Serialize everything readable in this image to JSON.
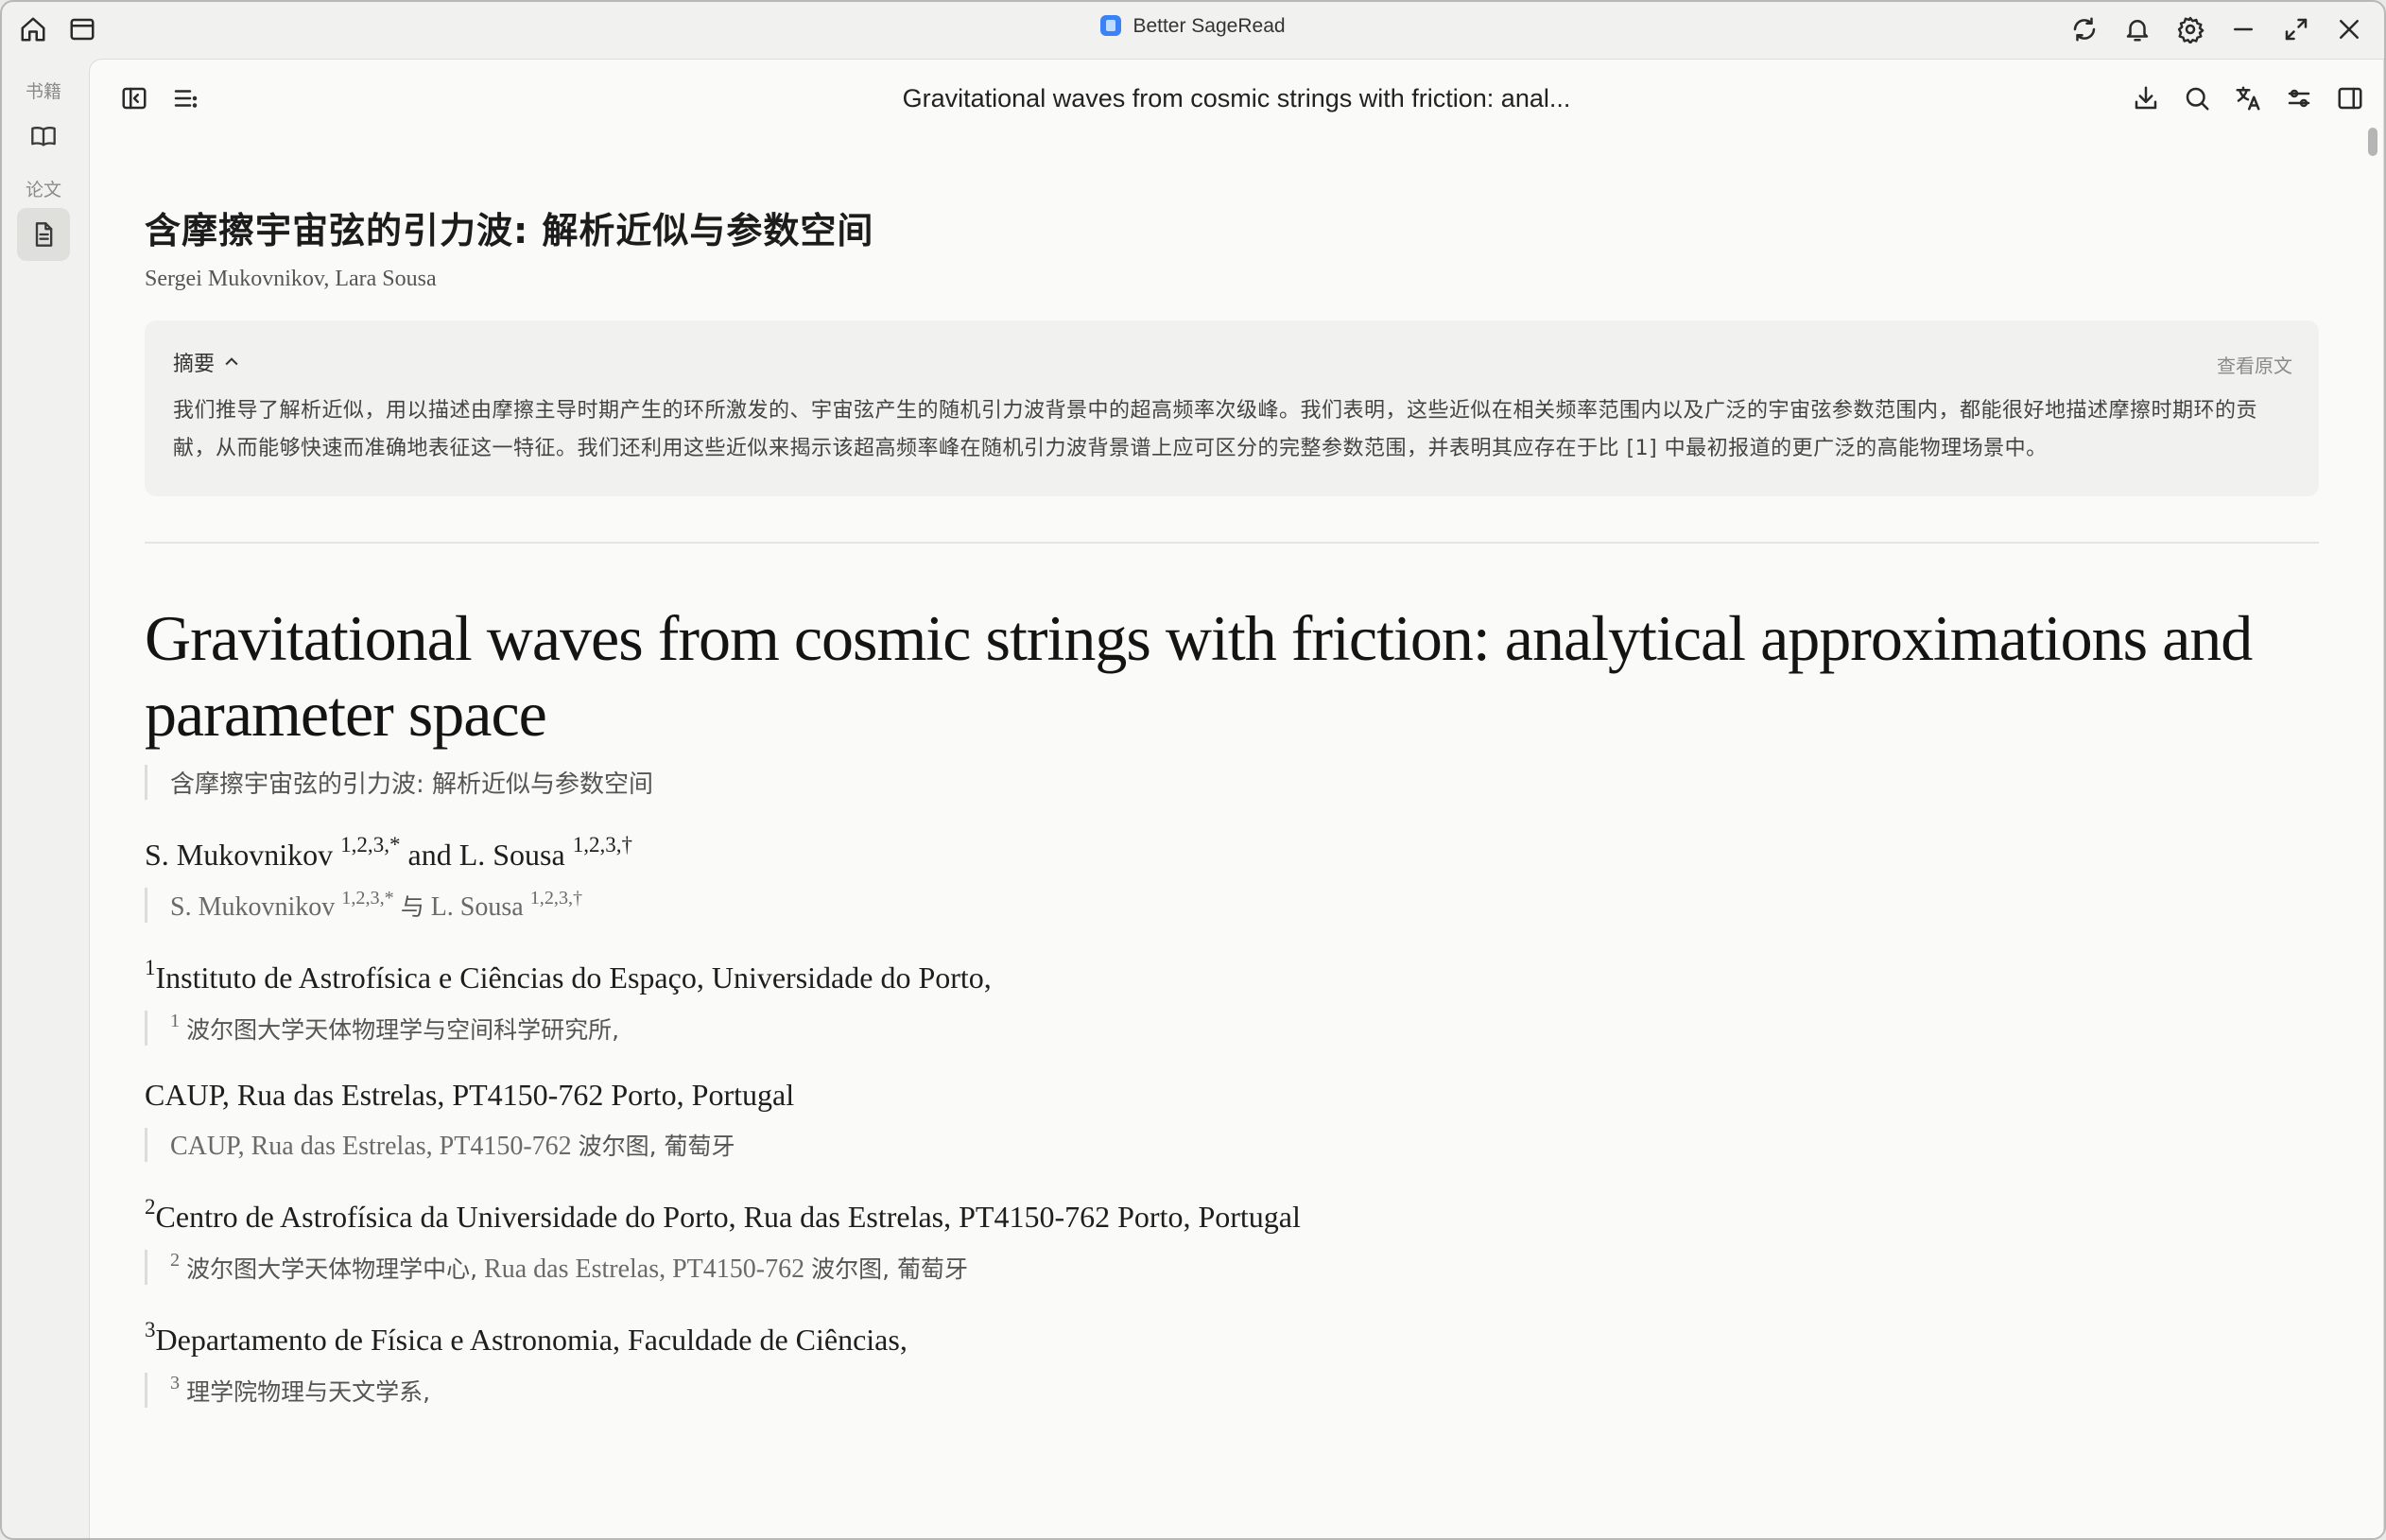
{
  "window": {
    "app_title": "Better SageRead"
  },
  "rail": {
    "label_books": "书籍",
    "label_papers": "论文"
  },
  "toolbar": {
    "doc_title": "Gravitational waves from cosmic strings with friction: anal..."
  },
  "paper": {
    "zh_title": "含摩擦宇宙弦的引力波: 解析近似与参数空间",
    "authors": "Sergei Mukovnikov, Lara Sousa",
    "abstract_label": "摘要",
    "view_original": "查看原文",
    "abstract_text": "我们推导了解析近似，用以描述由摩擦主导时期产生的环所激发的、宇宙弦产生的随机引力波背景中的超高频率次级峰。我们表明，这些近似在相关频率范围内以及广泛的宇宙弦参数范围内，都能很好地描述摩擦时期环的贡献，从而能够快速而准确地表征这一特征。我们还利用这些近似来揭示该超高频率峰在随机引力波背景谱上应可区分的完整参数范围，并表明其应存在于比 [1] 中最初报道的更广泛的高能物理场景中。",
    "en_title": "Gravitational waves from cosmic strings with friction: analytical approximations and parameter space",
    "en_title_tr": "含摩擦宇宙弦的引力波: 解析近似与参数空间",
    "author_line": {
      "a1": "S. Mukovnikov",
      "a1_sup": "1,2,3,*",
      "and": "and",
      "a2": "L. Sousa",
      "a2_sup": "1,2,3,†"
    },
    "author_line_tr": {
      "a1": "S. Mukovnikov",
      "a1_sup": "1,2,3,*",
      "and": "与",
      "a2": "L. Sousa",
      "a2_sup": "1,2,3,†"
    },
    "affiliations": [
      {
        "sup": "1",
        "text": "Instituto de Astrofísica e Ciências do Espaço, Universidade do Porto,",
        "tr_sup": "1",
        "tr_zh": "波尔图大学天体物理学与空间科学研究所,"
      },
      {
        "text": "CAUP, Rua das Estrelas, PT4150-762 Porto, Portugal",
        "tr_latin": "CAUP, Rua das Estrelas, PT4150-762",
        "tr_zh": "波尔图, 葡萄牙"
      },
      {
        "sup": "2",
        "text": "Centro de Astrofísica da Universidade do Porto, Rua das Estrelas, PT4150-762 Porto, Portugal",
        "tr_sup": "2",
        "tr_zh_a": "波尔图大学天体物理学中心,",
        "tr_latin": "Rua das Estrelas, PT4150-762",
        "tr_zh_b": "波尔图, 葡萄牙"
      },
      {
        "sup": "3",
        "text": "Departamento de Física e Astronomia, Faculdade de Ciências,",
        "tr_sup": "3",
        "tr_zh": "理学院物理与天文学系,"
      }
    ]
  }
}
